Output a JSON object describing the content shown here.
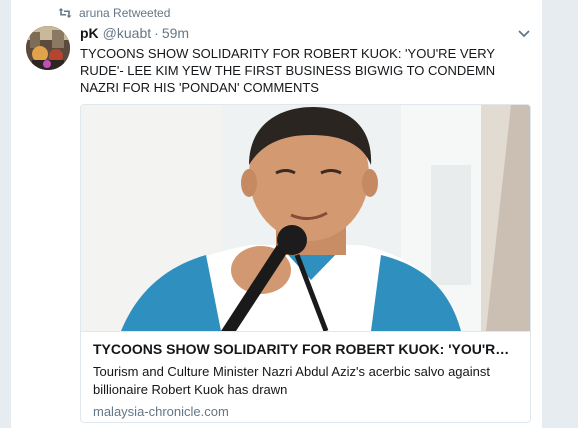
{
  "retweet": {
    "icon": "retweet-icon",
    "label": "aruna Retweeted"
  },
  "tweet": {
    "author_name": "pK",
    "handle": "@kuabt",
    "separator": "·",
    "time": "59m",
    "text": "TYCOONS SHOW SOLIDARITY FOR ROBERT KUOK: 'YOU'RE VERY RUDE'- LEE KIM YEW THE FIRST BUSINESS BIGWIG TO CONDEMN NAZRI FOR HIS 'PONDAN' COMMENTS",
    "menu_icon": "chevron-down-icon"
  },
  "card": {
    "title": "TYCOONS SHOW SOLIDARITY FOR ROBERT KUOK: 'YOU'RE VERY RUDE'- LEE KIM YEW THE FIRST BUSINESS BIGWIG",
    "description": "Tourism and Culture Minister Nazri Abdul Aziz's acerbic salvo against billionaire Robert Kuok has drawn",
    "domain": "malaysia-chronicle.com"
  },
  "colors": {
    "background": "#e6ecf0",
    "muted_text": "#657786",
    "primary_text": "#14171a",
    "border": "#e1e8ed"
  }
}
